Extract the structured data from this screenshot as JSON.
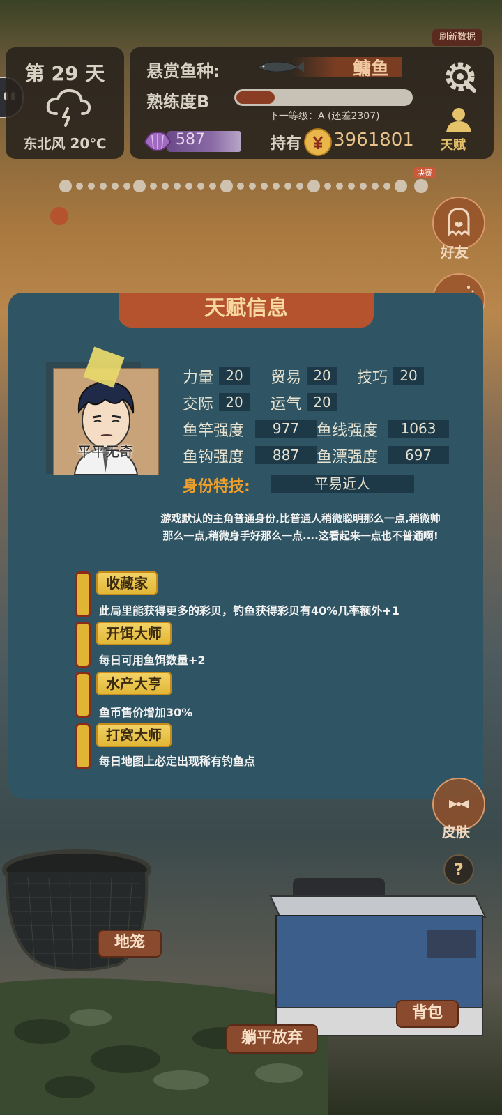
{
  "header": {
    "refresh_label": "刷新数据",
    "day": "第 29 天",
    "weather_icon": "thunderstorm-icon",
    "wind": "东北风 20℃",
    "bounty_label": "悬赏鱼种:",
    "bounty_fish": "鳙鱼",
    "proficiency_label": "熟练度B",
    "proficiency_progress": 0.22,
    "next_level": "下一等级：A (还差2307)",
    "gems": "587",
    "hold_label": "持有",
    "coins": "3961801",
    "talent_label": "天赋"
  },
  "progress": {
    "final_tag": "决赛"
  },
  "side": {
    "friend_label": "好友",
    "skin_label": "皮肤",
    "help_label": "?"
  },
  "modal": {
    "title": "天赋信息",
    "portrait_name": "平平无奇",
    "stats": {
      "strength_label": "力量",
      "strength": "20",
      "trade_label": "贸易",
      "trade": "20",
      "skill_label": "技巧",
      "skill": "20",
      "social_label": "交际",
      "social": "20",
      "luck_label": "运气",
      "luck": "20",
      "rod_label": "鱼竿强度",
      "rod": "977",
      "line_label": "鱼线强度",
      "line": "1063",
      "hook_label": "鱼钩强度",
      "hook": "887",
      "float_label": "鱼漂强度",
      "float": "697"
    },
    "identity_label": "身份特技:",
    "identity_value": "平易近人",
    "description_line1": "游戏默认的主角普通身份,比普通人稍微聪明那么一点,稍微帅",
    "description_line2": "那么一点,稍微身手好那么一点....这看起来一点也不普通啊!",
    "talents": [
      {
        "name": "收藏家",
        "desc": "此局里能获得更多的彩贝，钓鱼获得彩贝有40%几率额外+1"
      },
      {
        "name": "开饵大师",
        "desc": "每日可用鱼饵数量+2"
      },
      {
        "name": "水产大亨",
        "desc": "鱼币售价增加30%"
      },
      {
        "name": "打窝大师",
        "desc": "每日地图上必定出现稀有钓鱼点"
      }
    ]
  },
  "bottom": {
    "cage_label": "地笼",
    "bag_label": "背包",
    "give_up_label": "躺平放弃"
  },
  "colors": {
    "modal_bg": "#2f5463",
    "header_orange": "#b4532d",
    "talent_gold": "#e0b534",
    "skill_orange": "#f0a02a"
  }
}
